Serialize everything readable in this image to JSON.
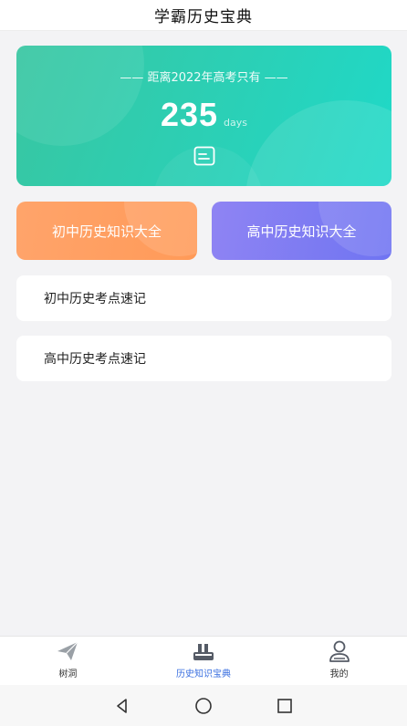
{
  "header": {
    "title": "学霸历史宝典"
  },
  "countdown": {
    "subtitle": "—— 距离2022年高考只有 ——",
    "days": "235",
    "unit": "days"
  },
  "buttons": {
    "junior": "初中历史知识大全",
    "senior": "高中历史知识大全"
  },
  "list": [
    {
      "label": "初中历史考点速记"
    },
    {
      "label": "高中历史考点速记"
    }
  ],
  "tabbar": {
    "tabs": [
      {
        "label": "树洞",
        "icon": "paper-plane-icon"
      },
      {
        "label": "历史知识宝典",
        "icon": "books-icon",
        "active": true
      },
      {
        "label": "我的",
        "icon": "user-icon"
      }
    ]
  },
  "colors": {
    "card_gradient_start": "#38c6a1",
    "card_gradient_end": "#1fd9c8",
    "junior_button": "#ffa46b",
    "senior_button": "#7d7af3",
    "active_tab": "#3a6fe0"
  }
}
